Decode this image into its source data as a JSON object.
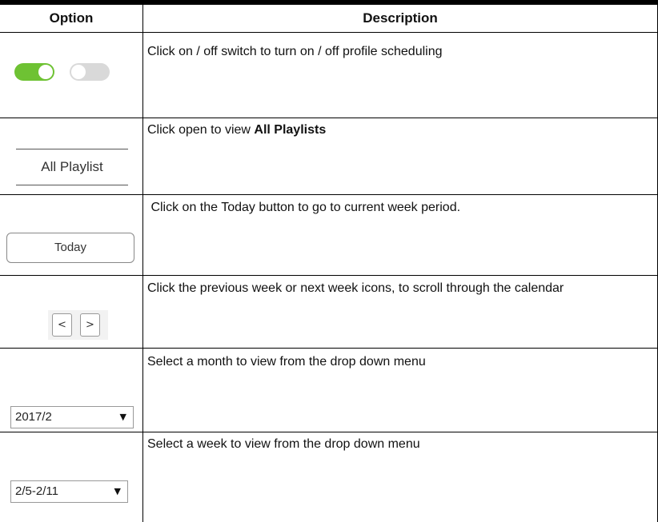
{
  "table": {
    "header": {
      "option": "Option",
      "description": "Description"
    },
    "rows": [
      {
        "control": {
          "type": "toggle-switches",
          "on_color": "#6ec233",
          "off_color": "#d9d9d9"
        },
        "description": "Click on / off switch to turn on / off profile scheduling"
      },
      {
        "control": {
          "type": "tab",
          "label": "All Playlist"
        },
        "description_prefix": "Click open to view ",
        "description_bold": "All Playlists"
      },
      {
        "control": {
          "type": "button",
          "label": "Today"
        },
        "description": " Click on the Today button to go to current week period."
      },
      {
        "control": {
          "type": "nav-buttons",
          "prev_label": "<",
          "next_label": ">"
        },
        "description": "Click the previous week or next week icons, to scroll through the calendar"
      },
      {
        "control": {
          "type": "dropdown",
          "value": "2017/2"
        },
        "description": "Select a month to view from the drop down menu"
      },
      {
        "control": {
          "type": "dropdown",
          "value": "2/5-2/11"
        },
        "description": "Select a week to view from the drop down menu"
      }
    ]
  }
}
